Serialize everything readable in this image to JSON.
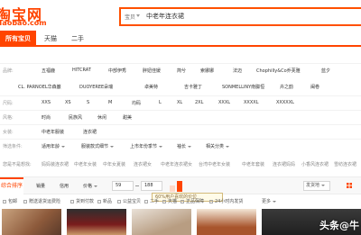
{
  "header": {
    "logo_text": "淘宝网",
    "logo_subtext": "Taobao.com",
    "search_scope": "宝贝",
    "search_query": "中老年连衣裙"
  },
  "tabs": [
    "所有宝贝",
    "天猫",
    "二手"
  ],
  "filters": {
    "brand_label": "品牌:",
    "brands_row1": [
      "五福鹿",
      "HITCRAT",
      "中部伊秀",
      "胖妞佳媛",
      "简兮",
      "索娜娜",
      "法迈",
      "Chophilly&Co乔芙雅",
      "蓝夕"
    ],
    "brands_row2": [
      "CL. PARNOEL华森巖",
      "DUOYEREE朵瑞",
      "卓美特",
      "吉卡雅丁",
      "SONMELLINY南朦恒",
      "卉之韵",
      "闽卷"
    ],
    "size_label": "尺码:",
    "sizes": [
      "XXS",
      "XS",
      "S",
      "M",
      "均码",
      "L",
      "XL",
      "2XL",
      "XXXL",
      "XXXXL",
      "XXXXXL"
    ],
    "style_label": "风格:",
    "styles": [
      "时尚",
      "民族风",
      "休闲",
      "甜美"
    ],
    "category_label": "女装:",
    "categories": [
      "中老年服装",
      "连衣裙"
    ],
    "pick_label": "筛选条件:",
    "picks": [
      "适用年龄",
      "服装款式细节",
      "上市年份季节",
      "袖长",
      "相关分类"
    ],
    "more_label": "更多"
  },
  "related": {
    "label": "您是不是想找:",
    "items": [
      "妈妈装连衣裙",
      "中老年女装",
      "中年女夏装",
      "连衣裙女",
      "中老年连衣裙女",
      "台湾中老年女装",
      "中老年套装",
      "连衣裙妈妈",
      "小香风连衣裙",
      "雪纺连衣裙"
    ]
  },
  "sortbar": {
    "active": "综合排序",
    "items": [
      "销量",
      "信用",
      "价格"
    ],
    "price_min": "59",
    "price_max": "188",
    "ship_label": "发货地",
    "histogram_percents": [
      35,
      60
    ]
  },
  "tooltip": "60%用户喜欢的价位",
  "checks": [
    "包邮",
    "赠送退货运费险",
    "货到付款",
    "新品",
    "公益宝贝",
    "二手",
    "天猫",
    "正品保障",
    "24小时内发货"
  ],
  "watermark": "头条@牛",
  "colors": {
    "accent": "#ff4400",
    "highlight_bar": "#ff4400",
    "soft_bar": "#ffd9c7"
  }
}
